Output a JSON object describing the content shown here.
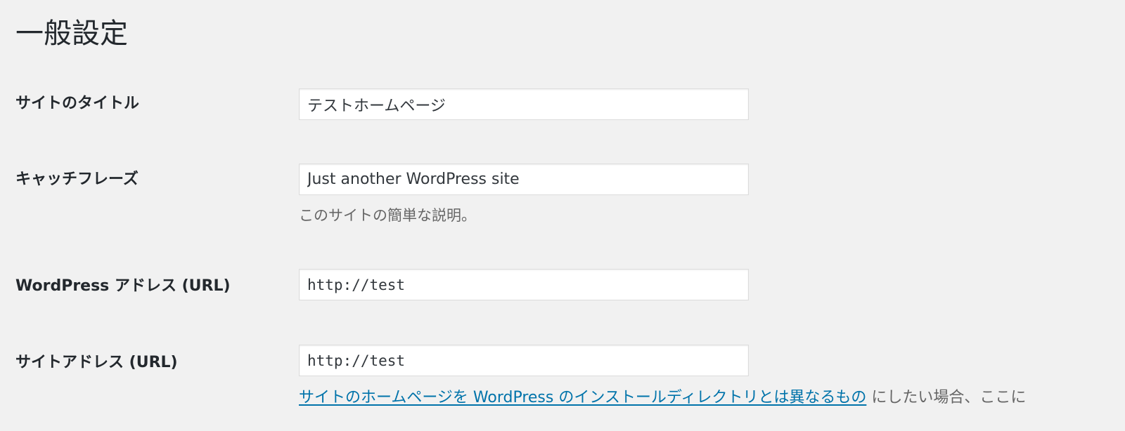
{
  "page": {
    "title": "一般設定"
  },
  "fields": {
    "site_title": {
      "label": "サイトのタイトル",
      "value": "テストホームページ"
    },
    "tagline": {
      "label": "キャッチフレーズ",
      "value": "Just another WordPress site",
      "description": "このサイトの簡単な説明。"
    },
    "wp_address": {
      "label": "WordPress アドレス (URL)",
      "value": "http://test"
    },
    "site_address": {
      "label": "サイトアドレス (URL)",
      "value": "http://test",
      "help_link_text": "サイトのホームページを WordPress のインストールディレクトリとは異なるもの",
      "help_suffix": " にしたい場合、ここに"
    }
  },
  "colors": {
    "background": "#f1f1f1",
    "link": "#0073aa",
    "description_text": "#666666"
  }
}
